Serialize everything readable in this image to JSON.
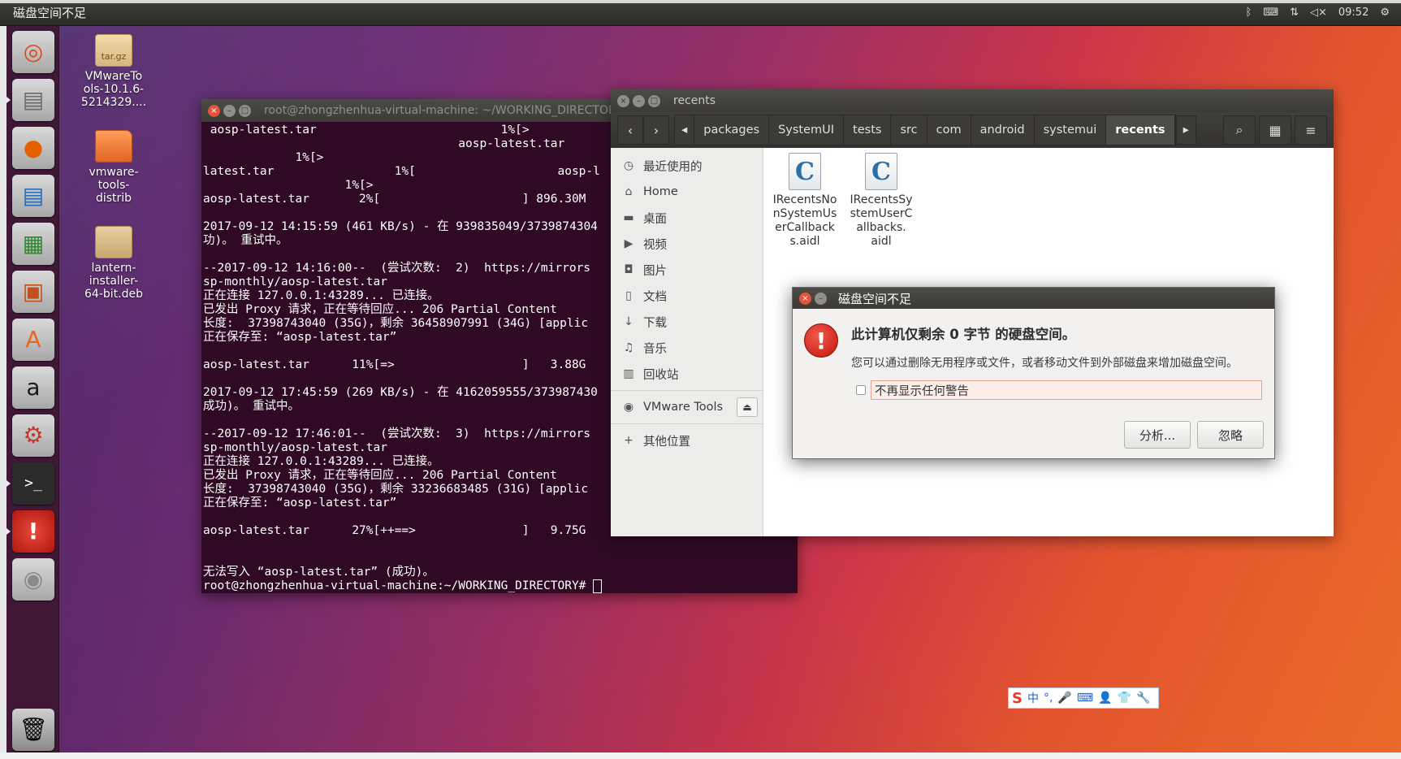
{
  "panel": {
    "title": "磁盘空间不足",
    "time": "09:52",
    "tray_icons": [
      "bluetooth-icon",
      "keyboard-icon",
      "network-icon",
      "volume-mute-icon"
    ]
  },
  "launcher": {
    "items": [
      {
        "name": "ubuntu-dash-icon",
        "glyph": "◎",
        "color": "#dd4814"
      },
      {
        "name": "files-icon",
        "glyph": "▤",
        "color": "#6b6b6b"
      },
      {
        "name": "firefox-icon",
        "glyph": "●",
        "color": "#e66000"
      },
      {
        "name": "libreoffice-writer-icon",
        "glyph": "▤",
        "color": "#2a6db5"
      },
      {
        "name": "libreoffice-calc-icon",
        "glyph": "▦",
        "color": "#2d8a2d"
      },
      {
        "name": "libreoffice-impress-icon",
        "glyph": "▣",
        "color": "#c0501e"
      },
      {
        "name": "software-center-icon",
        "glyph": "A",
        "color": "#e8651e"
      },
      {
        "name": "amazon-icon",
        "glyph": "a",
        "color": "#1a1a1a"
      },
      {
        "name": "system-settings-icon",
        "glyph": "⚙",
        "color": "#c23a2a"
      },
      {
        "name": "terminal-icon",
        "glyph": ">_",
        "color": "#2b2b2b"
      },
      {
        "name": "error-icon",
        "glyph": "!",
        "color": "#d32f20"
      },
      {
        "name": "dvd-icon",
        "glyph": "◉",
        "color": "#8a8a8a"
      }
    ],
    "trash": "trash-icon"
  },
  "desktop": {
    "icons": [
      {
        "label": "VMwareTo\nols-10.1.6-\n5214329....",
        "badge": "tar.gz",
        "type": "archive"
      },
      {
        "label": "vmware-\ntools-\ndistrib",
        "badge": "",
        "type": "folder"
      },
      {
        "label": "lantern-\ninstaller-\n64-bit.deb",
        "badge": "",
        "type": "pkg"
      }
    ]
  },
  "terminal": {
    "title": "root@zhongzhenhua-virtual-machine: ~/WORKING_DIRECTORY",
    "lines": [
      " aosp-latest.tar                          1%[>",
      "                                    aosp-latest.tar",
      "             1%[>",
      "latest.tar                 1%[                    aosp-l",
      "                    1%[>",
      "aosp-latest.tar       2%[                    ] 896.30M",
      "",
      "2017-09-12 14:15:59 (461 KB/s) - 在 939835049/3739874304",
      "功)。 重试中。",
      "",
      "--2017-09-12 14:16:00--  (尝试次数:  2)  https://mirrors",
      "sp-monthly/aosp-latest.tar",
      "正在连接 127.0.0.1:43289... 已连接。",
      "已发出 Proxy 请求，正在等待回应... 206 Partial Content",
      "长度:  37398743040 (35G)，剩余 36458907991 (34G) [applic",
      "正在保存至: “aosp-latest.tar”",
      "",
      "aosp-latest.tar      11%[=>                  ]   3.88G",
      "",
      "2017-09-12 17:45:59 (269 KB/s) - 在 4162059555/373987430",
      "成功)。 重试中。",
      "",
      "--2017-09-12 17:46:01--  (尝试次数:  3)  https://mirrors",
      "sp-monthly/aosp-latest.tar",
      "正在连接 127.0.0.1:43289... 已连接。",
      "已发出 Proxy 请求，正在等待回应... 206 Partial Content",
      "长度:  37398743040 (35G)，剩余 33236683485 (31G) [applic",
      "正在保存至: “aosp-latest.tar”",
      "",
      "aosp-latest.tar      27%[++==>               ]   9.75G",
      "",
      "",
      "无法写入 “aosp-latest.tar” (成功)。"
    ],
    "prompt": "root@zhongzhenhua-virtual-machine:~/WORKING_DIRECTORY# "
  },
  "files": {
    "title": "recents",
    "breadcrumbs": [
      "packages",
      "SystemUI",
      "tests",
      "src",
      "com",
      "android",
      "systemui",
      "recents"
    ],
    "sidebar": [
      {
        "icon": "clock-icon",
        "glyph": "◷",
        "label": "最近使用的"
      },
      {
        "icon": "home-icon",
        "glyph": "⌂",
        "label": "Home"
      },
      {
        "icon": "desktop-folder-icon",
        "glyph": "▬",
        "label": "桌面"
      },
      {
        "icon": "video-icon",
        "glyph": "▶",
        "label": "视频"
      },
      {
        "icon": "camera-icon",
        "glyph": "◘",
        "label": "图片"
      },
      {
        "icon": "document-icon",
        "glyph": "▯",
        "label": "文档"
      },
      {
        "icon": "download-icon",
        "glyph": "↓",
        "label": "下载"
      },
      {
        "icon": "music-icon",
        "glyph": "♫",
        "label": "音乐"
      },
      {
        "icon": "trash-icon",
        "glyph": "▥",
        "label": "回收站"
      }
    ],
    "device": {
      "icon": "disc-icon",
      "glyph": "◉",
      "label": "VMware Tools"
    },
    "other": {
      "icon": "plus-icon",
      "glyph": "+",
      "label": "其他位置"
    },
    "items": [
      {
        "label": "IRecentsNo\nnSystemUs\nerCallback\ns.aidl",
        "glyph": "C"
      },
      {
        "label": "IRecentsSy\nstemUserC\nallbacks.\naidl",
        "glyph": "C"
      }
    ]
  },
  "dialog": {
    "title": "磁盘空间不足",
    "primary": "此计算机仅剩余 0 字节 的硬盘空间。",
    "secondary": "您可以通过删除无用程序或文件，或者移动文件到外部磁盘来增加磁盘空间。",
    "checkbox_label": "不再显示任何警告",
    "analyze_label": "分析...",
    "ignore_label": "忽略"
  },
  "ime": {
    "logo": "S",
    "items": [
      "中",
      "°,",
      "🎤",
      "⌨",
      "👤",
      "👕",
      "🔧"
    ]
  }
}
